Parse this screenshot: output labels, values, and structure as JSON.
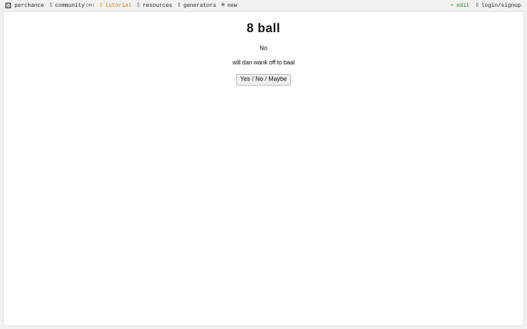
{
  "nav": {
    "brand": "perchance",
    "community": "community",
    "community_count": "(6h)",
    "tutorial": "tutorial",
    "resources": "resources",
    "generators": "generators",
    "new": "new",
    "edit": "edit",
    "login": "login/signup"
  },
  "icons": {
    "brand": "dice-icon",
    "community": "chat-icon",
    "tutorial": "book-icon",
    "resources": "book-icon",
    "generators": "list-icon",
    "new": "plus-circle-icon",
    "edit": "pencil-icon",
    "login": "user-icon"
  },
  "colors": {
    "tutorial": "#e07b00",
    "edit": "#2f8f2f"
  },
  "main": {
    "title": "8 ball",
    "answer": "No",
    "question": "will dan wank off to baal",
    "button_label": "Yes / No / Maybe"
  }
}
